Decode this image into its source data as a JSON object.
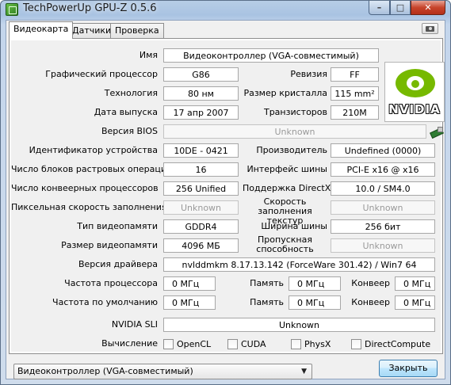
{
  "window": {
    "title": "TechPowerUp GPU-Z 0.5.6",
    "min_glyph": "–",
    "max_glyph": "□",
    "close_glyph": "✕"
  },
  "tabs": [
    {
      "label": "Видеокарта",
      "active": true
    },
    {
      "label": "Датчики",
      "active": false
    },
    {
      "label": "Проверка",
      "active": false
    }
  ],
  "card": {
    "name": {
      "label": "Имя",
      "value": "Видеоконтроллер (VGA-совместимый)"
    },
    "gpu": {
      "label": "Графический процессор",
      "value": "G86"
    },
    "revision": {
      "label": "Ревизия",
      "value": "FF"
    },
    "technology": {
      "label": "Технология",
      "value": "80 нм"
    },
    "die_size": {
      "label": "Размер кристалла",
      "value": "115 mm²"
    },
    "release": {
      "label": "Дата выпуска",
      "value": "17 апр 2007"
    },
    "transistors": {
      "label": "Транзисторов",
      "value": "210M"
    },
    "bios": {
      "label": "Версия BIOS",
      "value": "Unknown"
    },
    "device_id": {
      "label": "Идентификатор устройства",
      "value": "10DE - 0421"
    },
    "vendor": {
      "label": "Производитель",
      "value": "Undefined (0000)"
    },
    "rops": {
      "label": "Число блоков растровых операций",
      "value": "16"
    },
    "bus": {
      "label": "Интерфейс шины",
      "value": "PCI-E x16 @ x16"
    },
    "shaders": {
      "label": "Число конвеерных процессоров",
      "value": "256 Unified"
    },
    "directx": {
      "label": "Поддержка DirectX",
      "value": "10.0 / SM4.0"
    },
    "pixel_fill": {
      "label": "Пиксельная скорость заполнения",
      "value": "Unknown"
    },
    "texture_fill": {
      "label": "Скорость заполнения текстур",
      "value": "Unknown"
    },
    "mem_type": {
      "label": "Тип видеопамяти",
      "value": "GDDR4"
    },
    "bus_width": {
      "label": "Ширина шины",
      "value": "256 бит"
    },
    "mem_size": {
      "label": "Размер видеопамяти",
      "value": "4096 МБ"
    },
    "bandwidth": {
      "label": "Пропускная способность",
      "value": "Unknown"
    },
    "driver": {
      "label": "Версия драйвера",
      "value": "nvlddmkm 8.17.13.142 (ForceWare 301.42) / Win7 64"
    },
    "gpu_clock": {
      "label": "Частота процессора",
      "value": "0 МГц"
    },
    "mem_clock": {
      "label": "Память",
      "value": "0 МГц"
    },
    "shader_clock": {
      "label": "Конвеер",
      "value": "0 МГц"
    },
    "default_clock": {
      "label": "Частота по умолчанию",
      "value": "0 МГц"
    },
    "default_mem": {
      "label": "Память",
      "value": "0 МГц"
    },
    "default_shader": {
      "label": "Конвеер",
      "value": "0 МГц"
    },
    "sli": {
      "label": "NVIDIA SLI",
      "value": "Unknown"
    },
    "compute": {
      "label": "Вычисление",
      "items": [
        {
          "label": "OpenCL",
          "checked": false
        },
        {
          "label": "CUDA",
          "checked": false
        },
        {
          "label": "PhysX",
          "checked": false
        },
        {
          "label": "DirectCompute",
          "checked": false
        }
      ]
    }
  },
  "logo": {
    "text": "NVIDIA",
    "color": "#76b900"
  },
  "footer": {
    "device_select": "Видеоконтроллер (VGA-совместимый)",
    "close_button": "Закрыть"
  }
}
